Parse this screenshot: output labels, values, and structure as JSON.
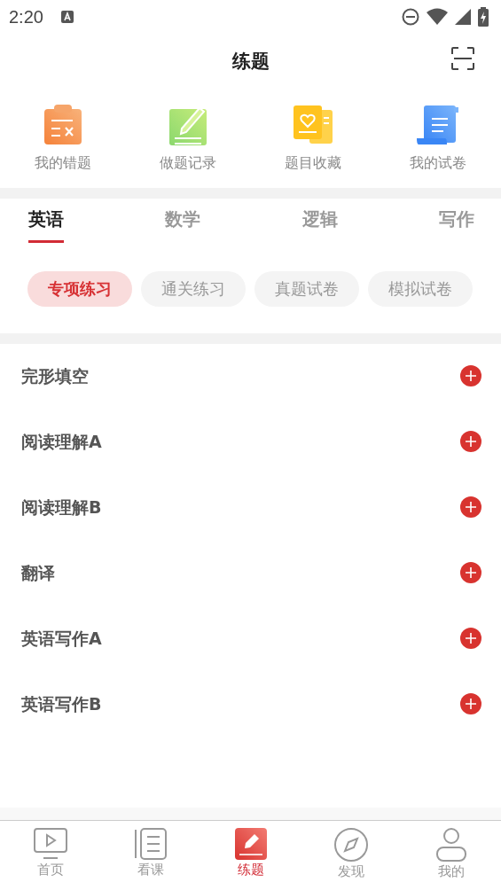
{
  "status_bar": {
    "time": "2:20"
  },
  "header": {
    "title": "练题"
  },
  "shortcuts": [
    {
      "label": "我的错题",
      "kind": "wrong"
    },
    {
      "label": "做题记录",
      "kind": "record"
    },
    {
      "label": "题目收藏",
      "kind": "favorite"
    },
    {
      "label": "我的试卷",
      "kind": "paper"
    }
  ],
  "tabs": [
    {
      "label": "英语",
      "selected": true
    },
    {
      "label": "数学",
      "selected": false
    },
    {
      "label": "逻辑",
      "selected": false
    },
    {
      "label": "写作",
      "selected": false
    }
  ],
  "chips": [
    {
      "label": "专项练习",
      "selected": true
    },
    {
      "label": "通关练习",
      "selected": false
    },
    {
      "label": "真题试卷",
      "selected": false
    },
    {
      "label": "模拟试卷",
      "selected": false
    }
  ],
  "items": [
    {
      "label": "完形填空"
    },
    {
      "label": "阅读理解A"
    },
    {
      "label": "阅读理解B"
    },
    {
      "label": "翻译"
    },
    {
      "label": "英语写作A"
    },
    {
      "label": "英语写作B"
    }
  ],
  "nav": [
    {
      "label": "首页",
      "kind": "home",
      "selected": false
    },
    {
      "label": "看课",
      "kind": "course",
      "selected": false
    },
    {
      "label": "练题",
      "kind": "practice",
      "selected": true
    },
    {
      "label": "发现",
      "kind": "discover",
      "selected": false
    },
    {
      "label": "我的",
      "kind": "me",
      "selected": false
    }
  ]
}
